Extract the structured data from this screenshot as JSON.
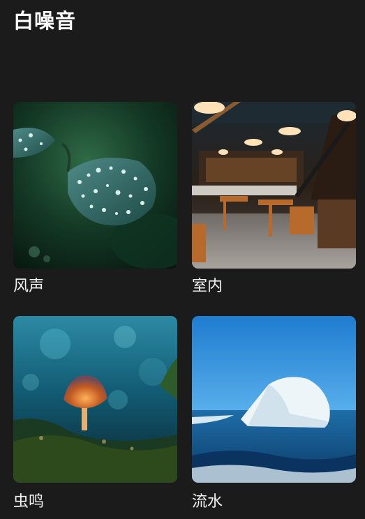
{
  "header": {
    "title": "白噪音"
  },
  "sounds": [
    {
      "label": "风声",
      "icon": "leaf-raindrops-image"
    },
    {
      "label": "室内",
      "icon": "cafe-interior-image"
    },
    {
      "label": "虫鸣",
      "icon": "glowing-mushroom-image"
    },
    {
      "label": "流水",
      "icon": "iceberg-ocean-image"
    }
  ],
  "colors": {
    "background": "#1b1b1b",
    "text": "#ffffff"
  }
}
